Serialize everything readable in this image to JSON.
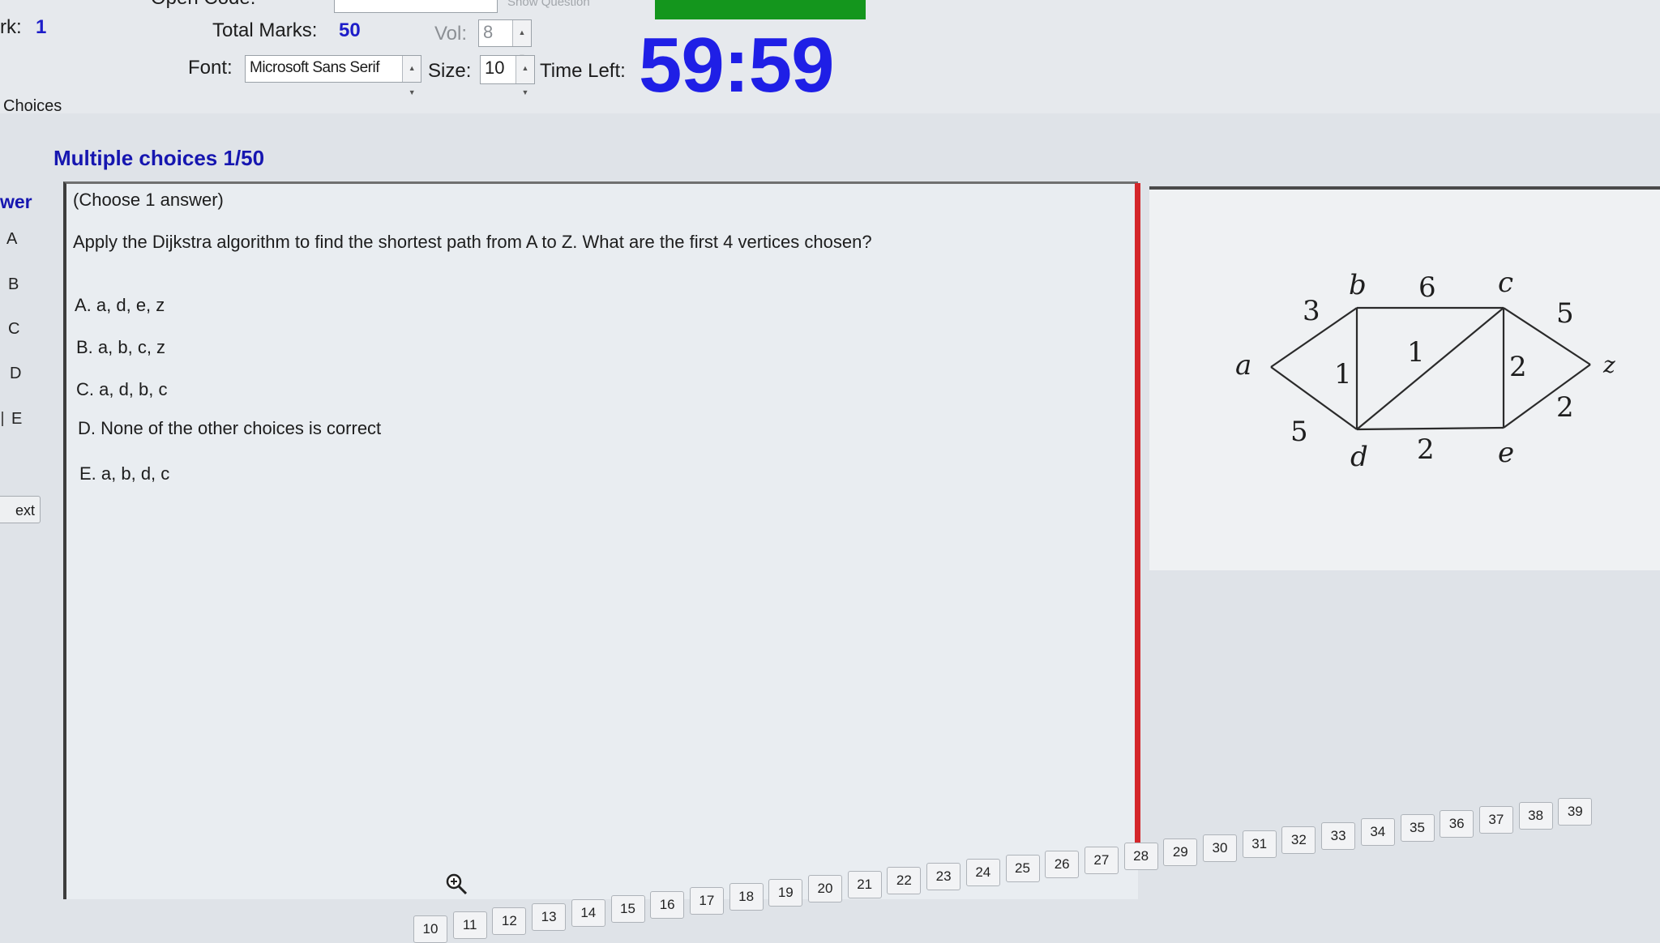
{
  "header": {
    "mark_label": "rk:",
    "mark_value": "1",
    "open_code_label": "Open Code:",
    "show_question_label": "Show Question",
    "total_marks_label": "Total Marks:",
    "total_marks_value": "50",
    "vol_label": "Vol:",
    "vol_value": "8",
    "font_label": "Font:",
    "font_value": "Microsoft Sans Serif",
    "size_label": "Size:",
    "size_value": "10",
    "time_left_label": "Time Left:",
    "timer": "59:59"
  },
  "left": {
    "choices_label": "Choices",
    "answer_header": "wer",
    "letters": [
      "A",
      "B",
      "C",
      "D",
      "E"
    ],
    "next_label": "ext"
  },
  "question": {
    "section_title": "Multiple choices 1/50",
    "instruction": "(Choose 1 answer)",
    "prompt": "Apply the Dijkstra algorithm to find the shortest path from A to Z. What are the first 4 vertices chosen?",
    "options": [
      "A.  a, d, e, z",
      "B.  a, b, c, z",
      "C.  a, d, b, c",
      "D.  None of the other choices is correct",
      "E.  a, b, d, c"
    ]
  },
  "graph": {
    "vertices": [
      "a",
      "b",
      "c",
      "d",
      "e",
      "z"
    ],
    "edges": [
      {
        "from": "a",
        "to": "b",
        "weight": "3"
      },
      {
        "from": "a",
        "to": "d",
        "weight": "5"
      },
      {
        "from": "b",
        "to": "c",
        "weight": "6"
      },
      {
        "from": "b",
        "to": "d",
        "weight": "1"
      },
      {
        "from": "d",
        "to": "c",
        "weight": "1"
      },
      {
        "from": "c",
        "to": "e",
        "weight": "2"
      },
      {
        "from": "d",
        "to": "e",
        "weight": "2"
      },
      {
        "from": "c",
        "to": "z",
        "weight": "5"
      },
      {
        "from": "e",
        "to": "z",
        "weight": "2"
      }
    ]
  },
  "question_numbers": [
    "10",
    "11",
    "12",
    "13",
    "14",
    "15",
    "16",
    "17",
    "18",
    "19",
    "20",
    "21",
    "22",
    "23",
    "24",
    "25",
    "26",
    "27",
    "28",
    "29",
    "30",
    "31",
    "32",
    "33",
    "34",
    "35",
    "36",
    "37",
    "38",
    "39"
  ],
  "colors": {
    "timer": "#1f1fe6",
    "accent_blue": "#1616b0",
    "divider_red": "#d4262a",
    "status_green": "#14961d"
  }
}
